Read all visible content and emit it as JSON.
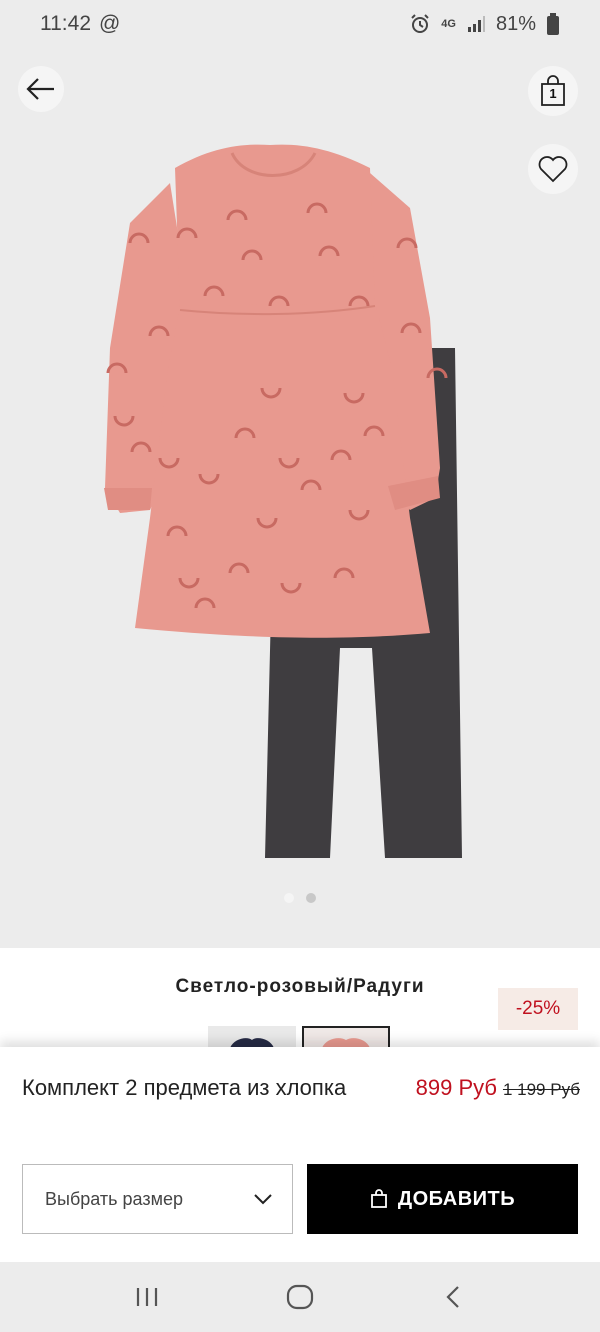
{
  "status_bar": {
    "time": "11:42",
    "at_symbol": "@",
    "network": "4G",
    "battery": "81%"
  },
  "header": {
    "bag_count": "1"
  },
  "product": {
    "color_name": "Светло-розовый/Радуги",
    "discount": "-25%",
    "title": "Комплект 2 предмета из хлопка",
    "price_new": "899 Руб",
    "price_old": "1 199 Руб"
  },
  "actions": {
    "size_placeholder": "Выбрать размер",
    "add_label": "ДОБАВИТЬ"
  },
  "carousel": {
    "total": 2,
    "active": 1
  },
  "colors": {
    "accent_red": "#c0111f",
    "dress_pink": "#e8998f",
    "leggings": "#3f3d40",
    "button_black": "#000000"
  }
}
